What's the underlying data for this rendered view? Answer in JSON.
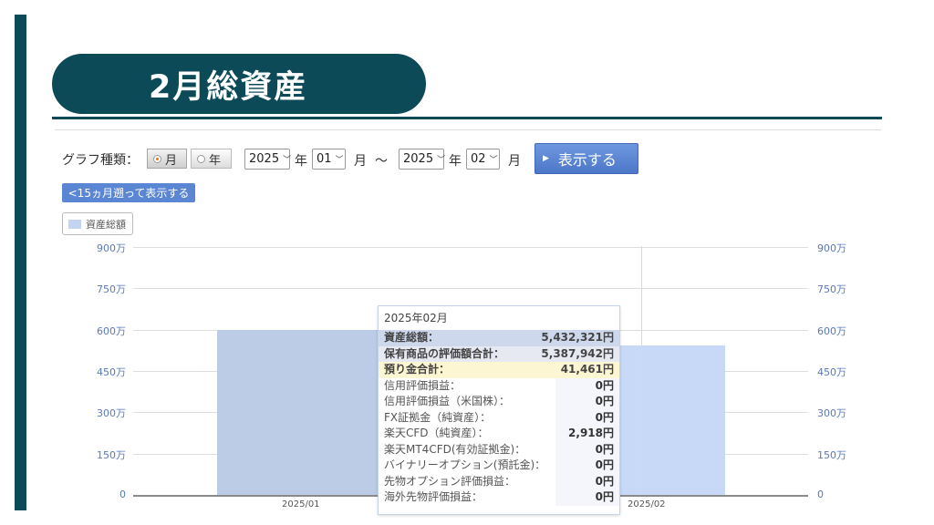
{
  "slide": {
    "title": "2月総資産"
  },
  "controls": {
    "graph_type_label": "グラフ種類：",
    "radio_month": "月",
    "radio_year": "年",
    "start_year": "2025",
    "start_year_unit": "年",
    "start_month": "01",
    "start_month_unit": "月",
    "range_separator": "〜",
    "end_year": "2025",
    "end_year_unit": "年",
    "end_month": "02",
    "end_month_unit": "月",
    "show_button": "表示する",
    "back_button": "<15ヵ月遡って表示する",
    "legend_label": "資産総額"
  },
  "chart_data": {
    "type": "bar",
    "categories": [
      "2025/01",
      "2025/02"
    ],
    "series": [
      {
        "name": "資産総額",
        "values": [
          6000000,
          5432321
        ]
      }
    ],
    "ylim": [
      0,
      9000000
    ],
    "y_ticks": [
      "0",
      "150万",
      "300万",
      "450万",
      "600万",
      "750万",
      "900万"
    ],
    "grid": true,
    "colors": {
      "bar_2025_01": "#bccbe6",
      "bar_2025_02": "#c8d9f8"
    }
  },
  "tooltip": {
    "title": "2025年02月",
    "rows": [
      {
        "label": "資産総額：",
        "value": "5,432,321円"
      },
      {
        "label": "保有商品の評価額合計：",
        "value": "5,387,942円"
      },
      {
        "label": "預り金合計：",
        "value": "41,461円"
      },
      {
        "label": "信用評価損益：",
        "value": "0円"
      },
      {
        "label": "信用評価損益（米国株）：",
        "value": "0円"
      },
      {
        "label": "FX証拠金（純資産）：",
        "value": "0円"
      },
      {
        "label": "楽天CFD（純資産）：",
        "value": "2,918円"
      },
      {
        "label": "楽天MT4CFD(有効証拠金)：",
        "value": "0円"
      },
      {
        "label": "バイナリーオプション(預託金)：",
        "value": "0円"
      },
      {
        "label": "先物オプション評価損益：",
        "value": "0円"
      },
      {
        "label": "海外先物評価損益：",
        "value": "0円"
      }
    ]
  },
  "colors": {
    "brand": "#0d4a57",
    "button": "#5b86d3",
    "axis_text": "#5a79b6"
  }
}
